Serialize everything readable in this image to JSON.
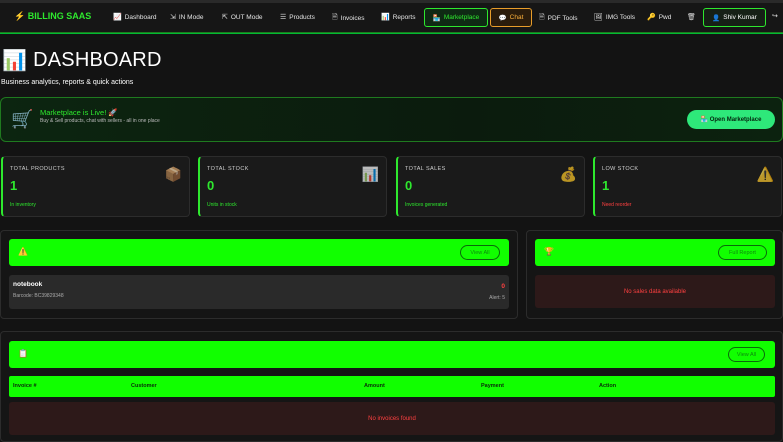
{
  "nav": {
    "brand": "⚡ BILLING SAAS",
    "items": [
      {
        "icon": "📈",
        "label": "Dashboard"
      },
      {
        "icon": "⇲",
        "label": "IN Mode"
      },
      {
        "icon": "⇱",
        "label": "OUT Mode"
      },
      {
        "icon": "☰",
        "label": "Products"
      },
      {
        "icon": "🗎",
        "label": "Invoices"
      },
      {
        "icon": "📊",
        "label": "Reports"
      }
    ],
    "marketplace": {
      "icon": "🏪",
      "label": "Marketplace"
    },
    "chat": {
      "icon": "💬",
      "label": "Chat"
    },
    "tools": [
      {
        "icon": "🗎",
        "label": "PDF Tools"
      },
      {
        "icon": "🖼",
        "label": "IMG Tools"
      },
      {
        "icon": "🔑",
        "label": "Pwd"
      },
      {
        "icon": "🗑",
        "label": ""
      }
    ],
    "user": {
      "icon": "👤",
      "label": "Shiv Kumar"
    },
    "logout_icon": "↪"
  },
  "page": {
    "icon": "📊",
    "title": "DASHBOARD",
    "subtitle": "Business analytics, reports & quick actions"
  },
  "banner": {
    "icon": "🛒",
    "title": "Marketplace is Live! 🚀",
    "text": "Buy & Sell products, chat with sellers - all in one place",
    "button": "🏪 Open Marketplace"
  },
  "stats": [
    {
      "label": "TOTAL PRODUCTS",
      "value": "1",
      "note": "In inventory",
      "icon": "📦"
    },
    {
      "label": "TOTAL STOCK",
      "value": "0",
      "note": "Units in stock",
      "icon": "📊"
    },
    {
      "label": "TOTAL SALES",
      "value": "0",
      "note": "Invoices generated",
      "icon": "💰"
    },
    {
      "label": "LOW STOCK",
      "value": "1",
      "note": "Need reorder",
      "icon": "⚠️"
    }
  ],
  "low_stock_panel": {
    "icon": "⚠️",
    "button": "View All",
    "item": {
      "name": "notebook",
      "barcode": "Barcode: BC39829348",
      "qty": "0",
      "alert": "Alert: 5"
    }
  },
  "top_sellers_panel": {
    "icon": "🏆",
    "button": "Full Report",
    "empty": "No sales data available"
  },
  "invoices_panel": {
    "icon": "📋",
    "button": "View All",
    "columns": [
      "Invoice #",
      "Customer",
      "Amount",
      "Payment",
      "Action"
    ],
    "empty": "No invoices found"
  },
  "colors": {
    "accent": "#2ee82e",
    "header_green": "#11ff00",
    "danger": "#ff4040",
    "chat": "#ffb23b"
  }
}
